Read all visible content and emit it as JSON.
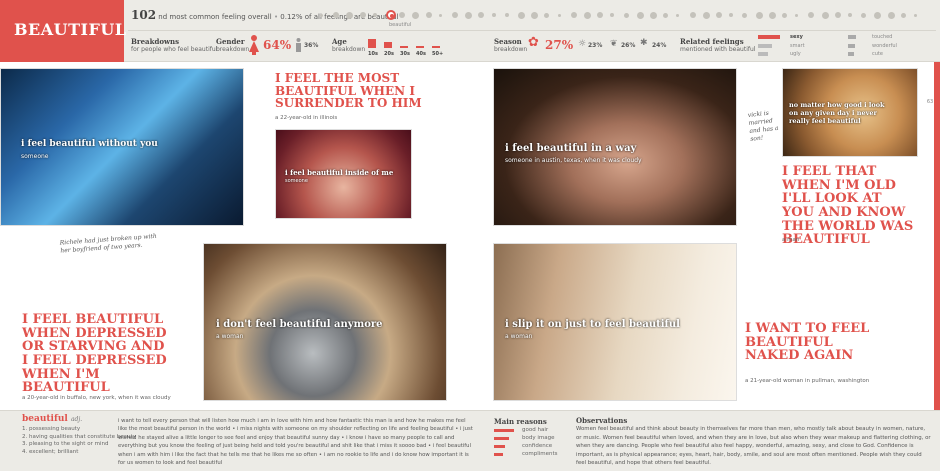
{
  "header": {
    "title": "BEAUTIFUL",
    "rank_number": "102",
    "rank_suffix": "nd most common feeling overall",
    "rank_share": "0.12% of all feelings are beautiful",
    "dot_label": "beautiful",
    "breakdowns_title": "Breakdowns",
    "breakdowns_sub": "for people who feel beautiful",
    "gender_title": "Gender",
    "gender_sub": "breakdown",
    "female_pct": "64%",
    "male_pct": "36%",
    "age_title": "Age",
    "age_sub": "breakdown",
    "age_groups": [
      {
        "label": "10s",
        "share": 0.55
      },
      {
        "label": "20s",
        "share": 0.35
      },
      {
        "label": "30s",
        "share": 0.12
      },
      {
        "label": "40s",
        "share": 0.05
      },
      {
        "label": "50+",
        "share": 0.05
      }
    ],
    "season_title": "Season",
    "season_sub": "breakdown",
    "spring_pct": "27%",
    "summer_pct": "23%",
    "fall_pct": "26%",
    "winter_pct": "24%",
    "related_title": "Related feelings",
    "related_sub": "mentioned with beautiful",
    "related_left": [
      "sexy",
      "smart",
      "ugly"
    ],
    "related_right": [
      "touched",
      "wonderful",
      "cute"
    ],
    "accent": "#e0524c"
  },
  "photos": [
    {
      "caption": "i feel beautiful without you",
      "sub": "someone"
    },
    {
      "caption": "i feel beautiful inside of me",
      "sub": "someone"
    },
    {
      "caption": "i feel beautiful in a way",
      "sub": "someone in austin, texas, when it was cloudy"
    },
    {
      "caption": "no matter how good i look on any given day i never really feel beautiful",
      "sub": ""
    },
    {
      "caption": "i don't feel beautiful anymore",
      "sub": "a woman"
    },
    {
      "caption": "i slip it on just to feel beautiful",
      "sub": "a woman"
    }
  ],
  "quotes": [
    {
      "text": "I FEEL THE MOST BEAUTIFUL WHEN I SURRENDER TO HIM",
      "sub": "a 22-year-old in illinois"
    },
    {
      "text": "I FEEL THAT WHEN I'M OLD I'LL LOOK AT YOU AND KNOW THE WORLD WAS BEAUTIFUL",
      "sub": "a man"
    },
    {
      "text": "I FEEL BEAUTIFUL WHEN DEPRESSED OR STARVING AND I FEEL DEPRESSED WHEN I'M BEAUTIFUL",
      "sub": "a 20-year-old in buffalo, new york, when it was cloudy"
    },
    {
      "text": "I WANT TO FEEL BEAUTIFUL NAKED AGAIN",
      "sub": "a 21-year-old woman in pullman, washington"
    }
  ],
  "notes": {
    "richele": "Richele had just broken up with her boyfriend of two years.",
    "vicki": "vicki is married and has a son!"
  },
  "page_number": "63",
  "footer": {
    "word": "beautiful",
    "pos": "adj.",
    "definitions": [
      "1. possessing beauty",
      "2. having qualities that constitute beauty",
      "3. pleasing to the sight or mind",
      "4. excellent; brilliant"
    ],
    "stories": "i want to tell every person that will listen how much i am in love with him and how fantastic this man is and how he makes me feel like the most beautiful person in the world • i miss nights with someone on my shoulder reflecting on life and feeling beautiful • i just wished he stayed alive a little longer to see feel and enjoy that beautiful sunny day • i know i have so many people to call and everything but you know the feeling of just being held and told you're beautiful and shit like that i miss it soooo bad • i feel beautiful when i am with him i like the fact that he tells me that he likes me so often • i am no rookie to life and i do know how important it is for us women to look and feel beautiful",
    "reasons_title": "Main reasons",
    "reasons": [
      {
        "label": "good hair",
        "share": 1.0
      },
      {
        "label": "body image",
        "share": 0.75
      },
      {
        "label": "confidence",
        "share": 0.55
      },
      {
        "label": "compliments",
        "share": 0.45
      }
    ],
    "obs_title": "Observations",
    "observations": "Women feel beautiful and think about beauty in themselves far more than men, who mostly talk about beauty in women, nature, or music. Women feel beautiful when loved, and when they are in love, but also when they wear makeup and flattering clothing, or when they are dancing. People who feel beautiful also feel happy, wonderful, amazing, sexy, and close to God. Confidence is important, as is physical appearance; eyes, heart, hair, body, smile, and soul are most often mentioned. People wish they could feel beautiful, and hope that others feel beautiful."
  }
}
